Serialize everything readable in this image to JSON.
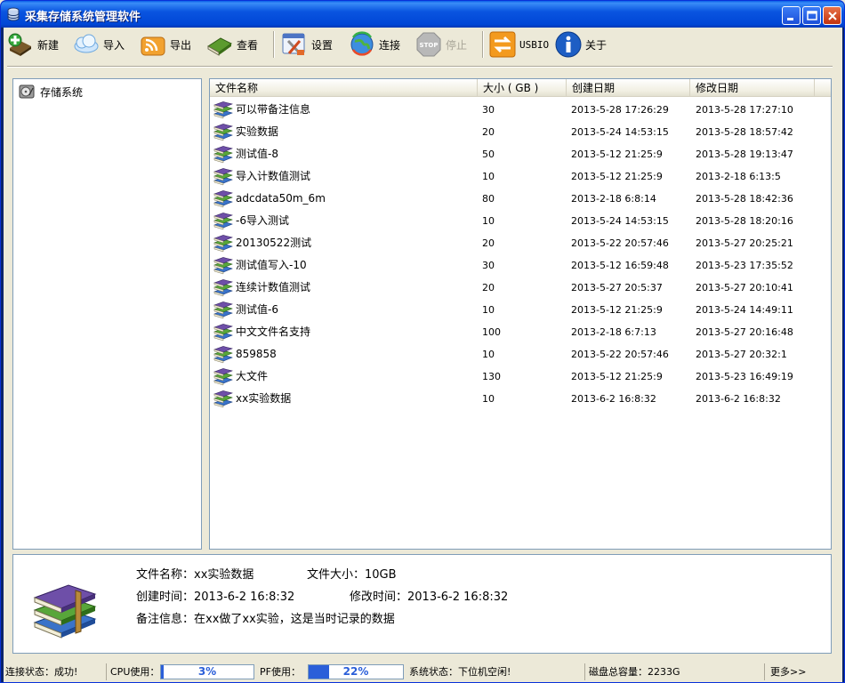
{
  "window": {
    "title": "采集存储系统管理软件"
  },
  "toolbar": {
    "items": [
      {
        "label": "新建",
        "icon": "new-icon",
        "enabled": true
      },
      {
        "label": "导入",
        "icon": "cloud-import-icon",
        "enabled": true
      },
      {
        "label": "导出",
        "icon": "rss-export-icon",
        "enabled": true
      },
      {
        "label": "查看",
        "icon": "book-view-icon",
        "enabled": true
      },
      {
        "label": "设置",
        "icon": "tools-settings-icon",
        "enabled": true
      },
      {
        "label": "连接",
        "icon": "globe-connect-icon",
        "enabled": true
      },
      {
        "label": "停止",
        "icon": "stop-icon",
        "enabled": false
      },
      {
        "label": "USBIO",
        "icon": "usb-arrows-icon",
        "enabled": true
      },
      {
        "label": "关于",
        "icon": "info-icon",
        "enabled": true
      }
    ]
  },
  "tree": {
    "root_label": "存储系统"
  },
  "list": {
    "columns": [
      "文件名称",
      "大小 ( GB )",
      "创建日期",
      "修改日期"
    ],
    "rows": [
      {
        "name": "可以带备注信息",
        "size": "30",
        "created": "2013-5-28 17:26:29",
        "modified": "2013-5-28 17:27:10"
      },
      {
        "name": "实验数据",
        "size": "20",
        "created": "2013-5-24 14:53:15",
        "modified": "2013-5-28 18:57:42"
      },
      {
        "name": "测试值-8",
        "size": "50",
        "created": "2013-5-12 21:25:9",
        "modified": "2013-5-28 19:13:47"
      },
      {
        "name": "导入计数值测试",
        "size": "10",
        "created": "2013-5-12 21:25:9",
        "modified": "2013-2-18 6:13:5"
      },
      {
        "name": "adcdata50m_6m",
        "size": "80",
        "created": "2013-2-18 6:8:14",
        "modified": "2013-5-28 18:42:36"
      },
      {
        "name": "-6导入测试",
        "size": "10",
        "created": "2013-5-24 14:53:15",
        "modified": "2013-5-28 18:20:16"
      },
      {
        "name": "20130522测试",
        "size": "20",
        "created": "2013-5-22 20:57:46",
        "modified": "2013-5-27 20:25:21"
      },
      {
        "name": "测试值写入-10",
        "size": "30",
        "created": "2013-5-12 16:59:48",
        "modified": "2013-5-23 17:35:52"
      },
      {
        "name": "连续计数值测试",
        "size": "20",
        "created": "2013-5-27 20:5:37",
        "modified": "2013-5-27 20:10:41"
      },
      {
        "name": "测试值-6",
        "size": "10",
        "created": "2013-5-12 21:25:9",
        "modified": "2013-5-24 14:49:11"
      },
      {
        "name": "中文文件名支持",
        "size": "100",
        "created": "2013-2-18 6:7:13",
        "modified": "2013-5-27 20:16:48"
      },
      {
        "name": "859858",
        "size": "10",
        "created": "2013-5-22 20:57:46",
        "modified": "2013-5-27 20:32:1"
      },
      {
        "name": "大文件",
        "size": "130",
        "created": "2013-5-12 21:25:9",
        "modified": "2013-5-23 16:49:19"
      },
      {
        "name": "xx实验数据",
        "size": "10",
        "created": "2013-6-2 16:8:32",
        "modified": "2013-6-2 16:8:32"
      }
    ]
  },
  "details": {
    "name_label": "文件名称：",
    "name_value": "xx实验数据",
    "size_label": "文件大小：",
    "size_value": "10GB",
    "created_label": "创建时间：",
    "created_value": "2013-6-2 16:8:32",
    "modified_label": "修改时间：",
    "modified_value": "2013-6-2 16:8:32",
    "note_label": "备注信息：",
    "note_value": "在xx做了xx实验，这是当时记录的数据"
  },
  "status": {
    "connection": "连接状态：成功!",
    "cpu_label": "CPU使用：",
    "cpu_percent": "3%",
    "cpu_fraction": 0.03,
    "pf_label": "PF使用：",
    "pf_percent": "22%",
    "pf_fraction": 0.22,
    "system": "系统状态：下位机空闲!",
    "disk": "磁盘总容量：2233G",
    "more": "更多>>"
  }
}
